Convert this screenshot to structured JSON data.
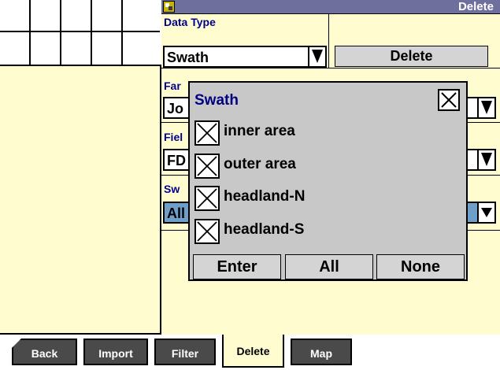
{
  "title_bar": {
    "title": "Delete"
  },
  "data_type": {
    "label": "Data Type",
    "value": "Swath"
  },
  "delete_button": "Delete",
  "farm": {
    "label": "Far",
    "value": "Jo"
  },
  "field": {
    "label": "Fiel",
    "value": "FD"
  },
  "swath_select": {
    "label": "Sw",
    "value": "All"
  },
  "modal": {
    "title": "Swath",
    "items": [
      {
        "label": "inner area",
        "checked": true
      },
      {
        "label": "outer area",
        "checked": true
      },
      {
        "label": "headland-N",
        "checked": true
      },
      {
        "label": "headland-S",
        "checked": true
      }
    ],
    "buttons": {
      "enter": "Enter",
      "all": "All",
      "none": "None"
    }
  },
  "tabs": [
    {
      "label": "Back"
    },
    {
      "label": "Import"
    },
    {
      "label": "Filter"
    },
    {
      "label": "Delete",
      "active": true
    },
    {
      "label": "Map"
    }
  ],
  "colors": {
    "panel": "#fffdd0",
    "title_bar": "#6f6f9d",
    "label": "#000090",
    "modal": "#c8c8c8"
  }
}
